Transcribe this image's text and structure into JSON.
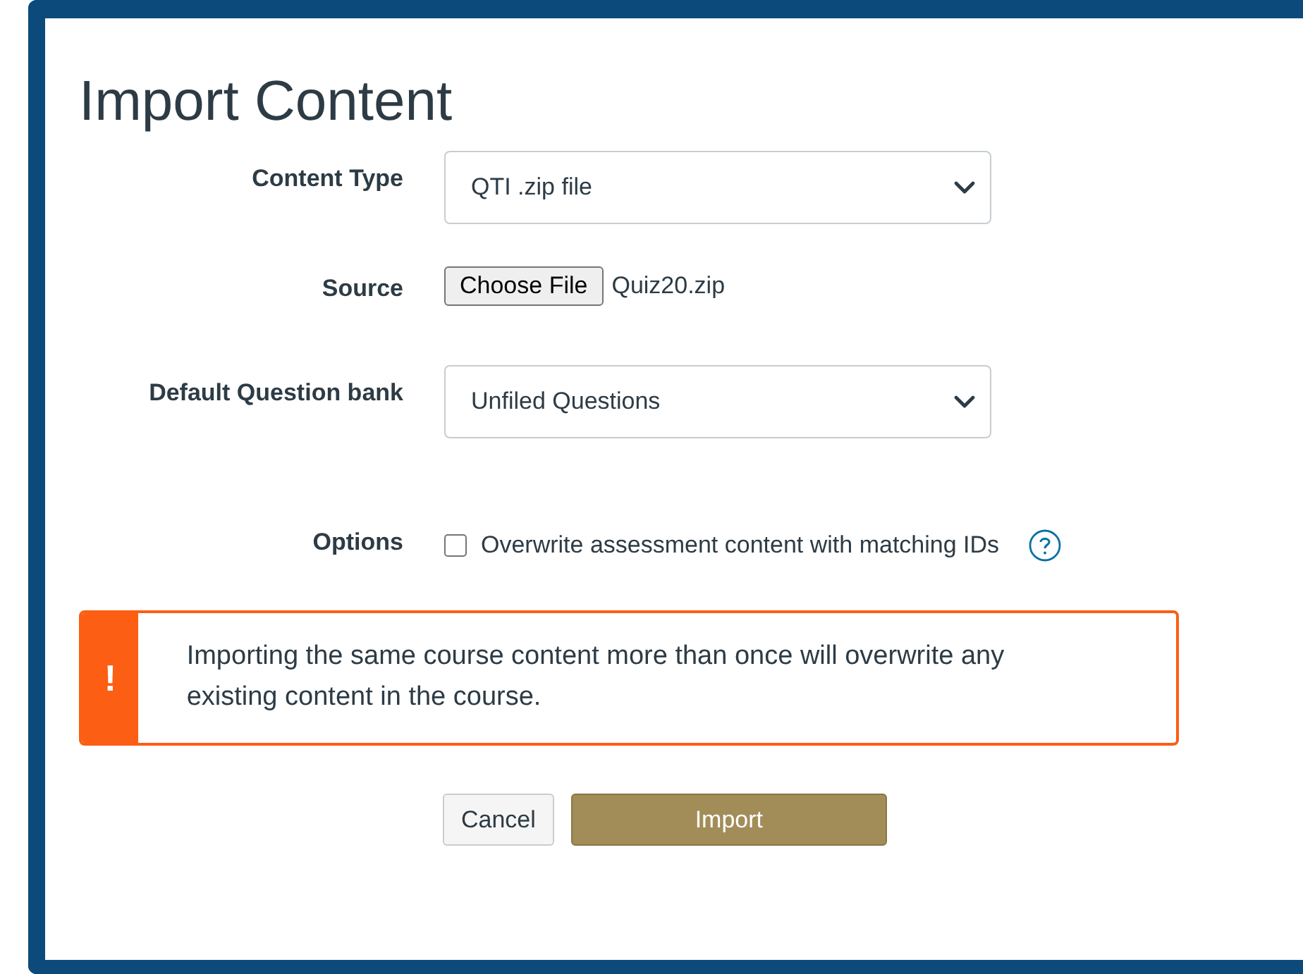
{
  "title": "Import Content",
  "fields": [
    {
      "kind": "select",
      "label": "Content Type",
      "value": "QTI .zip file"
    },
    {
      "kind": "file",
      "label": "Source",
      "button": "Choose File",
      "value": "Quiz20.zip"
    },
    {
      "kind": "select",
      "label": "Default Question bank",
      "value": "Unfiled Questions"
    },
    {
      "kind": "checkbox",
      "label": "Options",
      "option": "Overwrite assessment content with matching IDs",
      "checked": false
    }
  ],
  "alert": {
    "mark": "!",
    "message": "Importing the same course content more than once will overwrite any existing content in the course."
  },
  "buttons": [
    {
      "kind": "secondary",
      "label": "Cancel"
    },
    {
      "kind": "primary",
      "label": "Import"
    }
  ]
}
